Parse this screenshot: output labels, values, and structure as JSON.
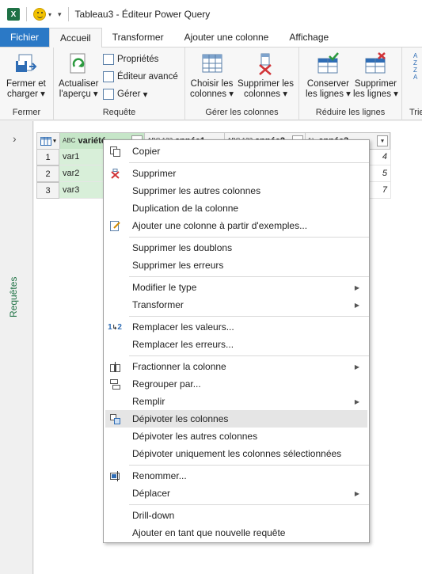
{
  "titlebar": {
    "title": "Tableau3 - Éditeur Power Query",
    "logo": "X"
  },
  "tabs": [
    "Fichier",
    "Accueil",
    "Transformer",
    "Ajouter une colonne",
    "Affichage"
  ],
  "ribbon": {
    "close_load": {
      "line1": "Fermer et",
      "line2": "charger",
      "group": "Fermer"
    },
    "refresh": {
      "line1": "Actualiser",
      "line2": "l'aperçu",
      "group": "Requête"
    },
    "properties": "Propriétés",
    "advanced_editor": "Éditeur avancé",
    "manage": "Gérer",
    "choose_cols": {
      "line1": "Choisir les",
      "line2": "colonnes"
    },
    "remove_cols": {
      "line1": "Supprimer les",
      "line2": "colonnes",
      "group": "Gérer les colonnes"
    },
    "keep_rows": {
      "line1": "Conserver",
      "line2": "les lignes"
    },
    "remove_rows": {
      "line1": "Supprimer",
      "line2": "les lignes",
      "group": "Réduire les lignes"
    },
    "sort_group": "Trie"
  },
  "sidebar": {
    "label": "Requêtes"
  },
  "grid": {
    "columns": [
      {
        "name": "variété",
        "type": "ABC"
      },
      {
        "name": "année1",
        "type": "ABC 123"
      },
      {
        "name": "année2",
        "type": "ABC 123"
      },
      {
        "name": "année3",
        "type": "1²₃"
      }
    ],
    "rows": [
      {
        "num": "1",
        "variete": "var1",
        "annee3": "4"
      },
      {
        "num": "2",
        "variete": "var2",
        "annee3": "5"
      },
      {
        "num": "3",
        "variete": "var3",
        "annee3": "7"
      }
    ]
  },
  "menu": {
    "items": [
      "Copier",
      "Supprimer",
      "Supprimer les autres colonnes",
      "Duplication de la colonne",
      "Ajouter une colonne à partir d'exemples...",
      "Supprimer les doublons",
      "Supprimer les erreurs",
      "Modifier le type",
      "Transformer",
      "Remplacer les valeurs...",
      "Remplacer les erreurs...",
      "Fractionner la colonne",
      "Regrouper par...",
      "Remplir",
      "Dépivoter les colonnes",
      "Dépivoter les autres colonnes",
      "Dépivoter uniquement les colonnes sélectionnées",
      "Renommer...",
      "Déplacer",
      "Drill-down",
      "Ajouter en tant que nouvelle requête"
    ]
  },
  "colors": {
    "file_tab": "#2b79c6",
    "selected_column": "#c6e6c8",
    "excel_green": "#217346"
  }
}
